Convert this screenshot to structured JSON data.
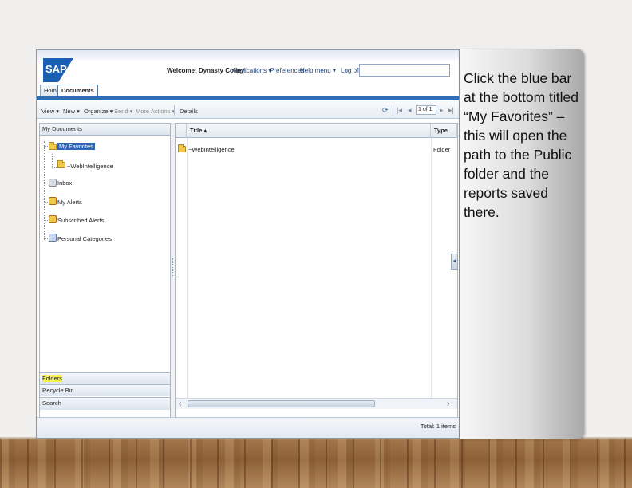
{
  "callout": {
    "text": "Click the blue bar at the bottom titled “My Favorites” – this will open the path to  the Public  folder and  the reports saved there."
  },
  "header": {
    "logo_text": "SAP",
    "welcome": "Welcome: Dynasty Colley",
    "links": [
      "Applications ▾",
      "Preferences",
      "Help menu ▾",
      "Log off"
    ],
    "search_value": ""
  },
  "tabs": [
    {
      "label": "Home",
      "active": false
    },
    {
      "label": "Documents",
      "active": true
    }
  ],
  "toolbar": {
    "items": [
      "View ▾",
      "New ▾",
      "Organize ▾",
      "Send ▾",
      "More Actions ▾",
      "Details"
    ],
    "page_value": "1",
    "page_total": "of 1"
  },
  "left_panel": {
    "header": "My Documents",
    "tree": [
      {
        "label": "My Favorites",
        "selected": true
      },
      {
        "label": "~WebIntelligence",
        "selected": false
      },
      {
        "label": "Inbox",
        "selected": false
      },
      {
        "label": "My Alerts",
        "selected": false
      },
      {
        "label": "Subscribed Alerts",
        "selected": false
      },
      {
        "label": "Personal Categories",
        "selected": false
      }
    ],
    "accordion": [
      "Folders",
      "Recycle Bin",
      "Search"
    ]
  },
  "list": {
    "columns": [
      "Title ▴",
      "Type"
    ],
    "rows": [
      {
        "title": "~WebIntelligence",
        "type": "Folder"
      }
    ]
  },
  "status": {
    "total": "Total: 1 items"
  },
  "colors": {
    "accent_blue": "#2f6db5",
    "highlight_yellow": "#f7f04b",
    "sap_blue": "#1a5fb4"
  }
}
